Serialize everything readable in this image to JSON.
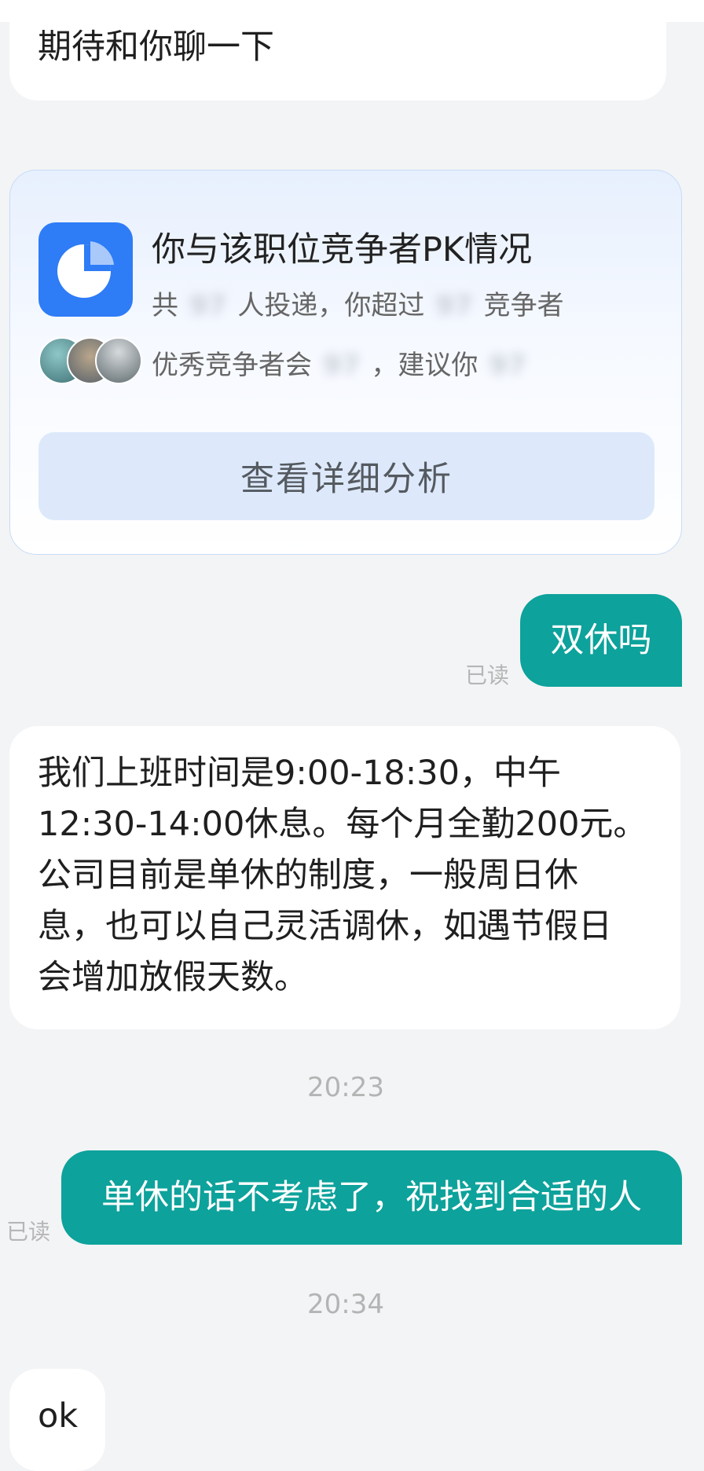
{
  "messages": {
    "first_incoming": "期待和你聊一下",
    "out_double_rest": "双休吗",
    "out_double_rest_status": "已读",
    "incoming_schedule": [
      "我们上班时间是9:00-18:30，中午",
      "12:30-14:00休息。每个月全勤200元。",
      "公司目前是单休的制度，一般周日休",
      "息，也可以自己灵活调休，如遇节假日",
      "会增加放假天数。"
    ],
    "time_1": "20:23",
    "out_decline": "单休的话不考虑了，祝找到合适的人",
    "out_decline_status": "已读",
    "time_2": "20:34",
    "last_incoming": "ok"
  },
  "pk_card": {
    "title": "你与该职位竞争者PK情况",
    "line1_prefix": "共",
    "line1_num1": "97",
    "line1_mid": "人投递，你超过",
    "line1_num2": "97",
    "line1_suffix": "竞争者",
    "line2_prefix": "优秀竞争者会",
    "line2_num1": "97",
    "line2_mid": "，建议你",
    "line2_num2": "97",
    "button_label": "查看详细分析",
    "icon": "pie-chart-icon"
  },
  "colors": {
    "outgoing_bubble": "#0da29b",
    "card_icon": "#2e7cf6",
    "card_button": "#dde9fb"
  }
}
